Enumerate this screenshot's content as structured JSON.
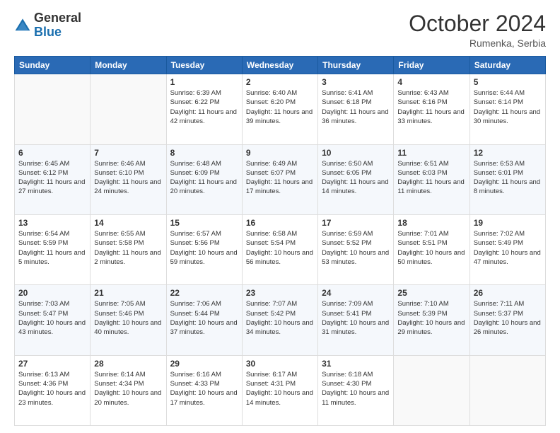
{
  "header": {
    "logo_general": "General",
    "logo_blue": "Blue",
    "month_title": "October 2024",
    "location": "Rumenka, Serbia"
  },
  "days_of_week": [
    "Sunday",
    "Monday",
    "Tuesday",
    "Wednesday",
    "Thursday",
    "Friday",
    "Saturday"
  ],
  "weeks": [
    [
      {
        "day": "",
        "info": ""
      },
      {
        "day": "",
        "info": ""
      },
      {
        "day": "1",
        "info": "Sunrise: 6:39 AM\nSunset: 6:22 PM\nDaylight: 11 hours and 42 minutes."
      },
      {
        "day": "2",
        "info": "Sunrise: 6:40 AM\nSunset: 6:20 PM\nDaylight: 11 hours and 39 minutes."
      },
      {
        "day": "3",
        "info": "Sunrise: 6:41 AM\nSunset: 6:18 PM\nDaylight: 11 hours and 36 minutes."
      },
      {
        "day": "4",
        "info": "Sunrise: 6:43 AM\nSunset: 6:16 PM\nDaylight: 11 hours and 33 minutes."
      },
      {
        "day": "5",
        "info": "Sunrise: 6:44 AM\nSunset: 6:14 PM\nDaylight: 11 hours and 30 minutes."
      }
    ],
    [
      {
        "day": "6",
        "info": "Sunrise: 6:45 AM\nSunset: 6:12 PM\nDaylight: 11 hours and 27 minutes."
      },
      {
        "day": "7",
        "info": "Sunrise: 6:46 AM\nSunset: 6:10 PM\nDaylight: 11 hours and 24 minutes."
      },
      {
        "day": "8",
        "info": "Sunrise: 6:48 AM\nSunset: 6:09 PM\nDaylight: 11 hours and 20 minutes."
      },
      {
        "day": "9",
        "info": "Sunrise: 6:49 AM\nSunset: 6:07 PM\nDaylight: 11 hours and 17 minutes."
      },
      {
        "day": "10",
        "info": "Sunrise: 6:50 AM\nSunset: 6:05 PM\nDaylight: 11 hours and 14 minutes."
      },
      {
        "day": "11",
        "info": "Sunrise: 6:51 AM\nSunset: 6:03 PM\nDaylight: 11 hours and 11 minutes."
      },
      {
        "day": "12",
        "info": "Sunrise: 6:53 AM\nSunset: 6:01 PM\nDaylight: 11 hours and 8 minutes."
      }
    ],
    [
      {
        "day": "13",
        "info": "Sunrise: 6:54 AM\nSunset: 5:59 PM\nDaylight: 11 hours and 5 minutes."
      },
      {
        "day": "14",
        "info": "Sunrise: 6:55 AM\nSunset: 5:58 PM\nDaylight: 11 hours and 2 minutes."
      },
      {
        "day": "15",
        "info": "Sunrise: 6:57 AM\nSunset: 5:56 PM\nDaylight: 10 hours and 59 minutes."
      },
      {
        "day": "16",
        "info": "Sunrise: 6:58 AM\nSunset: 5:54 PM\nDaylight: 10 hours and 56 minutes."
      },
      {
        "day": "17",
        "info": "Sunrise: 6:59 AM\nSunset: 5:52 PM\nDaylight: 10 hours and 53 minutes."
      },
      {
        "day": "18",
        "info": "Sunrise: 7:01 AM\nSunset: 5:51 PM\nDaylight: 10 hours and 50 minutes."
      },
      {
        "day": "19",
        "info": "Sunrise: 7:02 AM\nSunset: 5:49 PM\nDaylight: 10 hours and 47 minutes."
      }
    ],
    [
      {
        "day": "20",
        "info": "Sunrise: 7:03 AM\nSunset: 5:47 PM\nDaylight: 10 hours and 43 minutes."
      },
      {
        "day": "21",
        "info": "Sunrise: 7:05 AM\nSunset: 5:46 PM\nDaylight: 10 hours and 40 minutes."
      },
      {
        "day": "22",
        "info": "Sunrise: 7:06 AM\nSunset: 5:44 PM\nDaylight: 10 hours and 37 minutes."
      },
      {
        "day": "23",
        "info": "Sunrise: 7:07 AM\nSunset: 5:42 PM\nDaylight: 10 hours and 34 minutes."
      },
      {
        "day": "24",
        "info": "Sunrise: 7:09 AM\nSunset: 5:41 PM\nDaylight: 10 hours and 31 minutes."
      },
      {
        "day": "25",
        "info": "Sunrise: 7:10 AM\nSunset: 5:39 PM\nDaylight: 10 hours and 29 minutes."
      },
      {
        "day": "26",
        "info": "Sunrise: 7:11 AM\nSunset: 5:37 PM\nDaylight: 10 hours and 26 minutes."
      }
    ],
    [
      {
        "day": "27",
        "info": "Sunrise: 6:13 AM\nSunset: 4:36 PM\nDaylight: 10 hours and 23 minutes."
      },
      {
        "day": "28",
        "info": "Sunrise: 6:14 AM\nSunset: 4:34 PM\nDaylight: 10 hours and 20 minutes."
      },
      {
        "day": "29",
        "info": "Sunrise: 6:16 AM\nSunset: 4:33 PM\nDaylight: 10 hours and 17 minutes."
      },
      {
        "day": "30",
        "info": "Sunrise: 6:17 AM\nSunset: 4:31 PM\nDaylight: 10 hours and 14 minutes."
      },
      {
        "day": "31",
        "info": "Sunrise: 6:18 AM\nSunset: 4:30 PM\nDaylight: 10 hours and 11 minutes."
      },
      {
        "day": "",
        "info": ""
      },
      {
        "day": "",
        "info": ""
      }
    ]
  ]
}
